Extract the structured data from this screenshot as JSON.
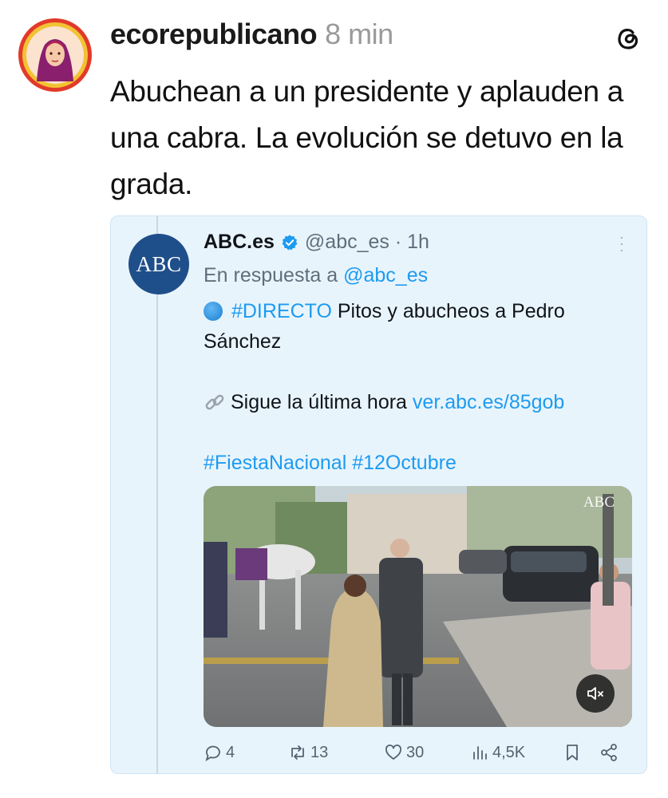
{
  "post": {
    "username": "ecorepublicano",
    "time": "8 min",
    "text": "Abuchean a un presidente y aplauden a una cabra. La evolución se detuvo en la grada.",
    "avatar_icon": "profile-avatar-icon",
    "app_icon": "threads-logo-icon"
  },
  "embed": {
    "avatar_text": "ABC",
    "name": "ABC.es",
    "handle": "@abc_es · 1h",
    "reply_prefix": "En respuesta a",
    "reply_handle": "@abc_es",
    "body": {
      "hashtag_directo": "#DIRECTO",
      "line1_rest": " Pitos y abucheos a Pedro Sánchez",
      "follow_text": "Sigue la última hora",
      "follow_link": "ver.abc.es/85gob",
      "hashtags": "#FiestaNacional #12Octubre"
    },
    "media_watermark": "ABC",
    "actions": {
      "replies": "4",
      "retweets": "13",
      "likes": "30",
      "views": "4,5K"
    },
    "colors": {
      "background": "#e8f4fc",
      "link": "#1d9bf0",
      "abc_blue": "#1f4f8a"
    }
  }
}
